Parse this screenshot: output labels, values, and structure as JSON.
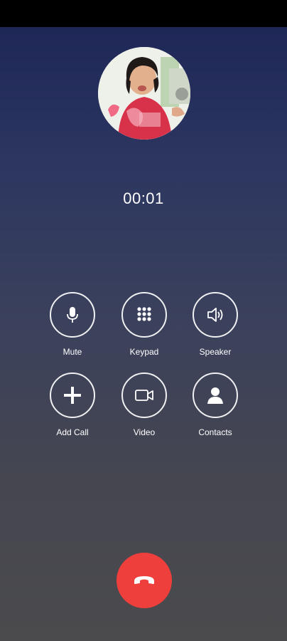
{
  "call": {
    "timer": "00:01"
  },
  "controls": [
    {
      "label": "Mute",
      "icon": "microphone-icon"
    },
    {
      "label": "Keypad",
      "icon": "keypad-icon"
    },
    {
      "label": "Speaker",
      "icon": "speaker-icon"
    },
    {
      "label": "Add Call",
      "icon": "plus-icon"
    },
    {
      "label": "Video",
      "icon": "video-camera-icon"
    },
    {
      "label": "Contacts",
      "icon": "person-icon"
    }
  ],
  "end_call": {
    "icon": "phone-hangup-icon",
    "color": "#ef3f3c"
  },
  "colors": {
    "background_top": "#1b2455",
    "background_bottom": "#4b4b4d"
  }
}
